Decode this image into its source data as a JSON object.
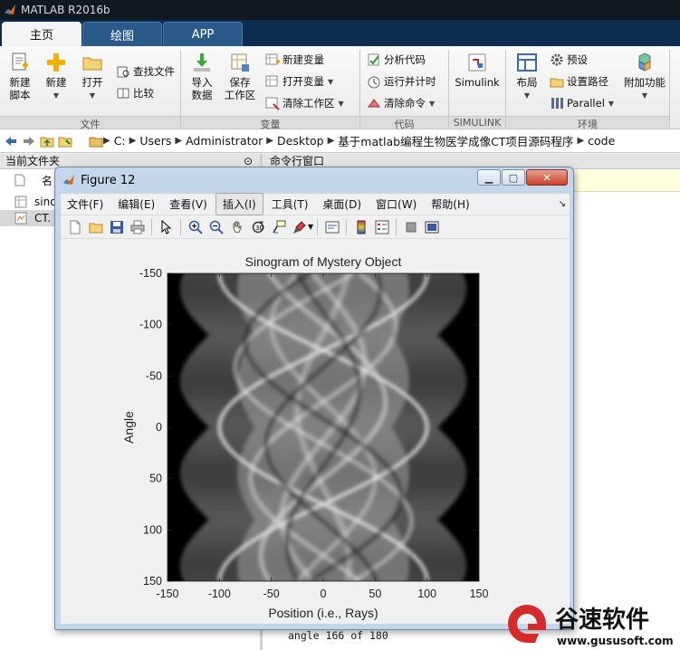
{
  "app": {
    "title": "MATLAB R2016b"
  },
  "tabs": [
    {
      "label": "主页",
      "active": true
    },
    {
      "label": "绘图",
      "active": false
    },
    {
      "label": "APP",
      "active": false
    }
  ],
  "ribbon": {
    "file": {
      "new_script": "新建\n脚本",
      "new": "新建",
      "open": "打开",
      "find_files": "查找文件",
      "compare": "比较",
      "group": "文件"
    },
    "variable": {
      "import": "导入\n数据",
      "save_ws": "保存\n工作区",
      "new_var": "新建变量",
      "open_var": "打开变量",
      "clear_ws": "清除工作区",
      "group": "变量"
    },
    "code": {
      "analyze": "分析代码",
      "run_time": "运行并计时",
      "clear_cmds": "清除命令",
      "group": "代码"
    },
    "simulink": {
      "label": "Simulink",
      "group": "SIMULINK"
    },
    "environment": {
      "layout": "布局",
      "prefs": "预设",
      "set_path": "设置路径",
      "parallel": "Parallel",
      "addons": "附加功能",
      "group": "环境"
    }
  },
  "address": {
    "crumbs": [
      "C:",
      "Users",
      "Administrator",
      "Desktop",
      "基于matlab编程生物医学成像CT项目源码程序",
      "code"
    ]
  },
  "current_folder": {
    "header": "当前文件夹",
    "column_name": "名",
    "files": [
      "sino",
      "CT."
    ]
  },
  "command_window": {
    "header": "命令行窗口",
    "lines": [
      "angle 166 of 180"
    ]
  },
  "figure": {
    "title": "Figure 12",
    "menus": [
      "文件(F)",
      "编辑(E)",
      "查看(V)",
      "插入(I)",
      "工具(T)",
      "桌面(D)",
      "窗口(W)",
      "帮助(H)"
    ],
    "menu_highlight_index": 3,
    "toolbar_icons": [
      "new-figure-icon",
      "open-file-icon",
      "save-icon",
      "print-icon",
      "pointer-icon",
      "zoom-in-icon",
      "zoom-out-icon",
      "pan-hand-icon",
      "rotate-3d-icon",
      "data-cursor-icon",
      "brush-icon",
      "link-plot-icon",
      "colorbar-icon",
      "legend-icon",
      "hide-plot-tools-icon",
      "show-plot-tools-icon"
    ]
  },
  "chart_data": {
    "type": "heatmap",
    "title": "Sinogram of Mystery Object",
    "xlabel": "Position (i.e., Rays)",
    "ylabel": "Angle",
    "xlim": [
      -150,
      150
    ],
    "ylim": [
      -150,
      150
    ],
    "y_reversed": true,
    "xticks": [
      -150,
      -100,
      -50,
      0,
      50,
      100,
      150
    ],
    "yticks": [
      -150,
      -100,
      -50,
      0,
      50,
      100,
      150
    ],
    "colormap": "gray"
  },
  "watermark": {
    "brand": "谷速软件",
    "url": "www.gususoft.com",
    "color": "#d42a2a"
  },
  "colors": {
    "tab_bar": "#0e2c4f",
    "title_bar": "#101820",
    "figure_frame": "#c4d6ea"
  }
}
